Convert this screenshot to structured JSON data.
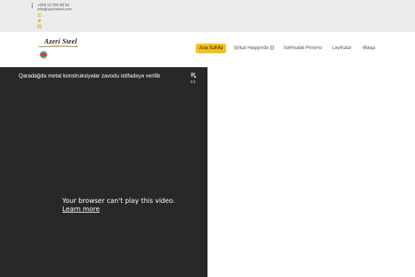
{
  "topbar": {
    "phone": "+994 12 555 88 56",
    "email": "info@azeristeel.com",
    "social_icons": [
      "facebook-icon",
      "twitter-icon",
      "linkedin-icon"
    ],
    "icon_color": "#e0a800"
  },
  "header": {
    "logo_text": "Azeri Steel",
    "flag_colors": [
      "#00b5e2",
      "#ef3340",
      "#509e2f"
    ]
  },
  "nav": {
    "items": [
      {
        "label": "Ana Səhifə",
        "active": true
      },
      {
        "label": "Şirkət Haqqında",
        "has_dropdown": true
      },
      {
        "label": "İstehsalat Prosesi"
      },
      {
        "label": "Layihələr"
      },
      {
        "label": "Əlaqə"
      }
    ],
    "accent": "#f4c01c"
  },
  "video": {
    "title": "Qaradağda metal konstruksiyalar zavodu istifadəyə verilib",
    "playlist_count": "1/1",
    "error_message": "Your browser can't play this video.",
    "learn_more": "Learn more"
  }
}
